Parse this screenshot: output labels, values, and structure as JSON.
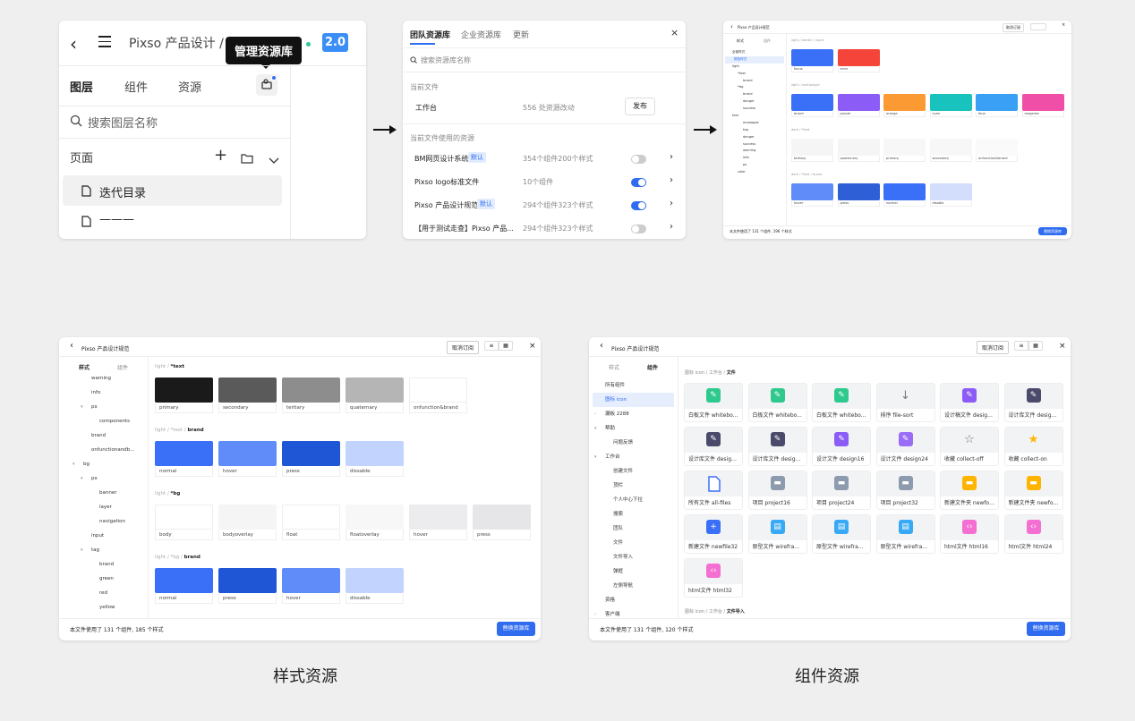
{
  "panel1": {
    "title": "Pixso 产品设计 /",
    "title_suffix": "迭代",
    "version": "2.0",
    "tooltip": "管理资源库",
    "tabs": [
      "图层",
      "组件",
      "资源"
    ],
    "search_placeholder": "搜索图层名称",
    "pages_label": "页面",
    "page_items": [
      "迭代目录",
      "———"
    ]
  },
  "panel2": {
    "tabs": [
      "团队资源库",
      "企业资源库",
      "更新"
    ],
    "search_placeholder": "搜索资源库名称",
    "current_file_label": "当前文件",
    "current_file": {
      "name": "工作台",
      "info": "556 处资源改动",
      "button": "发布"
    },
    "used_label": "当前文件使用的资源",
    "libraries": [
      {
        "name": "BM网页设计系统",
        "badge": "默认",
        "info": "354个组件200个样式",
        "on": false
      },
      {
        "name": "Pixso logo标准文件",
        "badge": "",
        "info": "10个组件",
        "on": true
      },
      {
        "name": "Pixso 产品设计规范",
        "badge": "默认",
        "info": "294个组件323个样式",
        "on": true
      },
      {
        "name": "【用于测试走查】Pixso 产品...",
        "badge": "",
        "info": "294个组件323个样式",
        "on": false
      }
    ]
  },
  "panel3": {
    "title": "Pixso 产品设计规范",
    "unsubscribe": "取消订阅",
    "tabs": [
      "样式",
      "组件"
    ],
    "tree": [
      "全部样式",
      "颜色样式",
      "light",
      "*text",
      "brand",
      "*bg",
      "brand",
      "danger",
      "success",
      "text",
      "onoaapps",
      "tag",
      "danger",
      "success",
      "warning",
      "info",
      "px",
      "color"
    ],
    "sections": [
      {
        "path": "light / border / input",
        "items": [
          {
            "name": "focus",
            "color": "#3a6ff7"
          },
          {
            "name": "error",
            "color": "#f5453a"
          }
        ]
      },
      {
        "path": "light / multiplayer",
        "items": [
          {
            "name": "brand",
            "color": "#3a6ff7"
          },
          {
            "name": "purple",
            "color": "#8b5cf6"
          },
          {
            "name": "orange",
            "color": "#fb9a32"
          },
          {
            "name": "cyan",
            "color": "#17c3bc"
          },
          {
            "name": "blue",
            "color": "#3aa0f5"
          },
          {
            "name": "magenta",
            "color": "#ef4fa6"
          }
        ]
      },
      {
        "path": "dark / *text",
        "items": [
          {
            "name": "tertiary",
            "color": "#f5f5f5"
          },
          {
            "name": "quaternary",
            "color": "#f5f5f5"
          },
          {
            "name": "primary",
            "color": "#f7f7f7"
          },
          {
            "name": "secondary",
            "color": "#f7f7f7"
          },
          {
            "name": "onfunction&brand",
            "color": "#fafafa"
          }
        ]
      },
      {
        "path": "dark / *text / brand",
        "items": [
          {
            "name": "hover",
            "color": "#5f8cf8"
          },
          {
            "name": "press",
            "color": "#2f5fd6"
          },
          {
            "name": "normal",
            "color": "#3a6ff7"
          },
          {
            "name": "disable",
            "color": "#d3defc"
          }
        ]
      }
    ],
    "footer": "本文件使用了 131 个组件, 196 个样式",
    "replace_button": "替换资源库"
  },
  "panel4": {
    "title": "Pixso 产品设计规范",
    "unsubscribe": "取消订阅",
    "tabs": [
      "样式",
      "组件"
    ],
    "tree": [
      {
        "label": "warning",
        "indent": 2,
        "arrow": ""
      },
      {
        "label": "info",
        "indent": 2,
        "arrow": ""
      },
      {
        "label": "px",
        "indent": 2,
        "arrow": "▾"
      },
      {
        "label": "components",
        "indent": 3,
        "arrow": ""
      },
      {
        "label": "brand",
        "indent": 2,
        "arrow": ""
      },
      {
        "label": "onfunctionandb...",
        "indent": 2,
        "arrow": ""
      },
      {
        "label": "bg",
        "indent": 1,
        "arrow": "▾"
      },
      {
        "label": "px",
        "indent": 2,
        "arrow": "▾"
      },
      {
        "label": "banner",
        "indent": 3,
        "arrow": ""
      },
      {
        "label": "layer",
        "indent": 3,
        "arrow": ""
      },
      {
        "label": "navigation",
        "indent": 3,
        "arrow": ""
      },
      {
        "label": "input",
        "indent": 2,
        "arrow": ""
      },
      {
        "label": "tag",
        "indent": 2,
        "arrow": "▾"
      },
      {
        "label": "brand",
        "indent": 3,
        "arrow": ""
      },
      {
        "label": "green",
        "indent": 3,
        "arrow": ""
      },
      {
        "label": "red",
        "indent": 3,
        "arrow": ""
      },
      {
        "label": "yellow",
        "indent": 3,
        "arrow": ""
      }
    ],
    "sections": [
      {
        "path": "light / ",
        "bold": "*text",
        "items": [
          {
            "name": "primary",
            "color": "#1a1a1a"
          },
          {
            "name": "secondary",
            "color": "#5a5a5a"
          },
          {
            "name": "tertiary",
            "color": "#8d8d8d"
          },
          {
            "name": "quaternary",
            "color": "#b5b5b5"
          },
          {
            "name": "onfunction&brand",
            "color": "#ffffff"
          }
        ]
      },
      {
        "path": "light / *text / ",
        "bold": "brand",
        "items": [
          {
            "name": "normal",
            "color": "#3a6ff7"
          },
          {
            "name": "hover",
            "color": "#5f8cf8"
          },
          {
            "name": "press",
            "color": "#1f56d6"
          },
          {
            "name": "dissable",
            "color": "#c2d4fd"
          }
        ]
      },
      {
        "path": "light / ",
        "bold": "*bg",
        "items": [
          {
            "name": "body",
            "color": "#ffffff"
          },
          {
            "name": "bodyoverlay",
            "color": "#f5f5f6"
          },
          {
            "name": "float",
            "color": "#ffffff"
          },
          {
            "name": "floatoverlay",
            "color": "#f7f7f7"
          },
          {
            "name": "hover",
            "color": "#ececee"
          },
          {
            "name": "press",
            "color": "#e6e6e8"
          }
        ]
      },
      {
        "path": "light / *bg / ",
        "bold": "brand",
        "items": [
          {
            "name": "normal",
            "color": "#3a6ff7"
          },
          {
            "name": "press",
            "color": "#1f56d6"
          },
          {
            "name": "hover",
            "color": "#5f8cf8"
          },
          {
            "name": "dissable",
            "color": "#c2d4fd"
          }
        ]
      }
    ],
    "footer": "本文件使用了 131 个组件, 185 个样式",
    "replace_button": "替换资源库",
    "caption": "样式资源"
  },
  "panel5": {
    "title": "Pixso 产品设计规范",
    "unsubscribe": "取消订阅",
    "tabs": [
      "样式",
      "组件"
    ],
    "tree": [
      {
        "label": "所有组件",
        "indent": 0,
        "arrow": "",
        "active": false
      },
      {
        "label": "图标 icon",
        "indent": 0,
        "arrow": "",
        "active": true
      },
      {
        "label": "漏板 2288",
        "indent": 0,
        "arrow": "›",
        "active": false
      },
      {
        "label": "帮助",
        "indent": 0,
        "arrow": "▾",
        "active": false
      },
      {
        "label": "问题反馈",
        "indent": 1,
        "arrow": "",
        "active": false
      },
      {
        "label": "工作台",
        "indent": 0,
        "arrow": "▾",
        "active": false
      },
      {
        "label": "创建文件",
        "indent": 1,
        "arrow": "",
        "active": false
      },
      {
        "label": "顶栏",
        "indent": 1,
        "arrow": "",
        "active": false
      },
      {
        "label": "个人中心下拉",
        "indent": 1,
        "arrow": "",
        "active": false
      },
      {
        "label": "搜索",
        "indent": 1,
        "arrow": "",
        "active": false
      },
      {
        "label": "团队",
        "indent": 1,
        "arrow": "",
        "active": false
      },
      {
        "label": "文件",
        "indent": 1,
        "arrow": "",
        "active": false
      },
      {
        "label": "文件导入",
        "indent": 1,
        "arrow": "",
        "active": false
      },
      {
        "label": "弹框",
        "indent": 1,
        "arrow": "",
        "active": false
      },
      {
        "label": "左侧导航",
        "indent": 1,
        "arrow": "",
        "active": false
      },
      {
        "label": "资格",
        "indent": 0,
        "arrow": "",
        "active": false
      },
      {
        "label": "客户端",
        "indent": 0,
        "arrow": "›",
        "active": false
      }
    ],
    "breadcrumb": "图标 icon / 工作台 / ",
    "breadcrumb_bold": "文件",
    "tiles": [
      {
        "label": "白板文件 whitebo...",
        "color": "#2fc98e",
        "glyph": "✎"
      },
      {
        "label": "白板文件 whitebo...",
        "color": "#2fc98e",
        "glyph": "✎"
      },
      {
        "label": "白板文件 whitebo...",
        "color": "#2fc98e",
        "glyph": "✎"
      },
      {
        "label": "排序 file-sort",
        "color": "",
        "glyph": "↓"
      },
      {
        "label": "设计稿文件 design...",
        "color": "#8b5cf6",
        "glyph": "✎"
      },
      {
        "label": "设计库文件 design...",
        "color": "#4b4a6b",
        "glyph": "✎"
      },
      {
        "label": "设计库文件 design...",
        "color": "#4b4a6b",
        "glyph": "✎"
      },
      {
        "label": "设计库文件 design...",
        "color": "#4b4a6b",
        "glyph": "✎"
      },
      {
        "label": "设计文件 design16",
        "color": "#8b5cf6",
        "glyph": "✎"
      },
      {
        "label": "设计文件 design24",
        "color": "#9a6cf8",
        "glyph": "✎"
      },
      {
        "label": "收藏 collect-off",
        "color": "",
        "glyph": "☆"
      },
      {
        "label": "收藏 collect-on",
        "color": "",
        "glyph": "★"
      },
      {
        "label": "所有文件 all-files",
        "color": "",
        "glyph": "doc"
      },
      {
        "label": "项目 project16",
        "color": "#8e9aae",
        "glyph": "▬"
      },
      {
        "label": "项目 project24",
        "color": "#8e9aae",
        "glyph": "▬"
      },
      {
        "label": "项目 project32",
        "color": "#8e9aae",
        "glyph": "▬"
      },
      {
        "label": "新建文件夹 newfol...",
        "color": "#ffb400",
        "glyph": "▬"
      },
      {
        "label": "新建文件夹 newfol...",
        "color": "#ffb400",
        "glyph": "▬"
      },
      {
        "label": "新建文件 newfile32",
        "color": "#3a6ff7",
        "glyph": "+"
      },
      {
        "label": "原型文件 wirefram...",
        "color": "#38a9f5",
        "glyph": "▤"
      },
      {
        "label": "原型文件 wirefram...",
        "color": "#38a9f5",
        "glyph": "▤"
      },
      {
        "label": "原型文件 wirefram...",
        "color": "#38a9f5",
        "glyph": "▤"
      },
      {
        "label": "html文件 html16",
        "color": "#f36fd1",
        "glyph": "‹›"
      },
      {
        "label": "html文件 html24",
        "color": "#f36fd1",
        "glyph": "‹›"
      },
      {
        "label": "html文件 html32",
        "color": "#f36fd1",
        "glyph": "‹›"
      }
    ],
    "breadcrumb2": "图标 icon / 工作台 / ",
    "breadcrumb2_bold": "文件导入",
    "footer": "本文件使用了 131 个组件, 120 个样式",
    "replace_button": "替换资源库",
    "caption": "组件资源"
  }
}
